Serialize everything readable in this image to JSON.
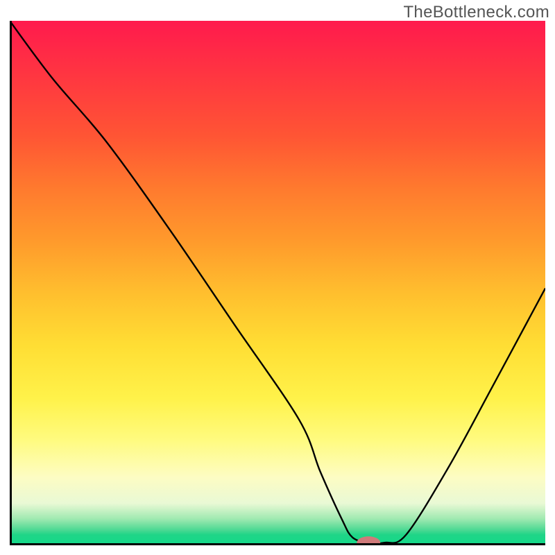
{
  "watermark": "TheBottleneck.com",
  "chart_data": {
    "type": "line",
    "title": "",
    "xlabel": "",
    "ylabel": "",
    "xlim": [
      0,
      100
    ],
    "ylim": [
      0,
      100
    ],
    "series": [
      {
        "name": "curve",
        "x": [
          0,
          8,
          18,
          30,
          42,
          54,
          58,
          62,
          64,
          67,
          70,
          74,
          82,
          90,
          100
        ],
        "y": [
          100,
          89,
          77,
          60,
          42,
          24,
          14,
          5,
          1.5,
          0.5,
          0.5,
          2,
          15,
          30,
          49
        ]
      }
    ],
    "marker": {
      "x": 67,
      "y": 0.5,
      "rx": 2.2,
      "ry": 1.2,
      "color": "#cf7a7a"
    },
    "gradient_stops": [
      {
        "pct": 0,
        "color": "#ff1a4d"
      },
      {
        "pct": 40,
        "color": "#ff8a2e"
      },
      {
        "pct": 70,
        "color": "#fff04a"
      },
      {
        "pct": 100,
        "color": "#14d98a"
      }
    ]
  }
}
